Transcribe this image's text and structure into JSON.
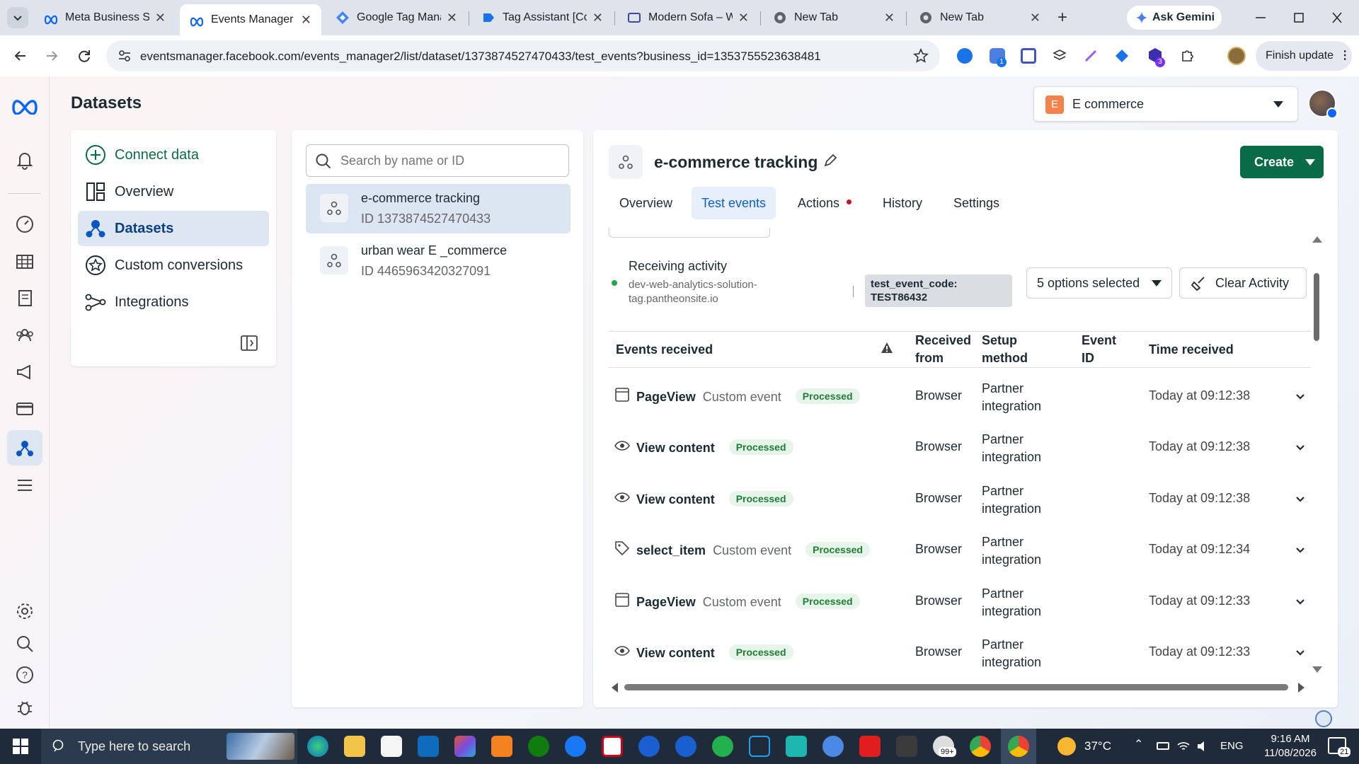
{
  "browser": {
    "tabs": [
      {
        "title": "Meta Business Su",
        "active": false
      },
      {
        "title": "Events Manager",
        "active": true
      },
      {
        "title": "Google Tag Mana",
        "active": false
      },
      {
        "title": "Tag Assistant [Co",
        "active": false
      },
      {
        "title": "Modern Sofa – W",
        "active": false
      },
      {
        "title": "New Tab",
        "active": false
      },
      {
        "title": "New Tab",
        "active": false
      }
    ],
    "url": "eventsmanager.facebook.com/events_manager2/list/dataset/1373874527470433/test_events?business_id=1353755523638481",
    "ask_gemini": "Ask Gemini",
    "finish_update": "Finish update",
    "ext_badge_1": "1",
    "ext_badge_2": "3"
  },
  "page": {
    "title": "Datasets",
    "account": {
      "initial": "E",
      "name": "E commerce"
    }
  },
  "nav": {
    "items": [
      {
        "label": "Connect data",
        "icon": "plus-circle-icon"
      },
      {
        "label": "Overview",
        "icon": "overview-icon"
      },
      {
        "label": "Datasets",
        "icon": "datasets-icon",
        "selected": true
      },
      {
        "label": "Custom conversions",
        "icon": "custom-conversions-icon"
      },
      {
        "label": "Integrations",
        "icon": "integrations-icon"
      }
    ]
  },
  "datasets": {
    "search_placeholder": "Search by name or ID",
    "items": [
      {
        "name": "e-commerce tracking",
        "id": "ID 1373874527470433",
        "selected": true
      },
      {
        "name": "urban wear E _commerce",
        "id": "ID 4465963420327091",
        "selected": false
      }
    ]
  },
  "detail": {
    "title": "e-commerce tracking",
    "create_label": "Create",
    "tabs": [
      "Overview",
      "Test events",
      "Actions",
      "History",
      "Settings"
    ],
    "activity": {
      "status": "Receiving activity",
      "site_line1": "dev-web-analytics-solution-",
      "site_line2": "tag.pantheonsite.io",
      "code_line1": "test_event_code:",
      "code_line2": "TEST86432",
      "filter": "5 options selected",
      "clear": "Clear Activity"
    },
    "columns": {
      "events": "Events received",
      "from_1": "Received",
      "from_2": "from",
      "setup_1": "Setup",
      "setup_2": "method",
      "eid_1": "Event",
      "eid_2": "ID",
      "time": "Time received"
    },
    "events": [
      {
        "name": "PageView",
        "type": "Custom event",
        "status": "Processed",
        "from": "Browser",
        "setup_1": "Partner",
        "setup_2": "integration",
        "time": "Today at 09:12:38",
        "icon": "page-icon"
      },
      {
        "name": "View content",
        "type": "",
        "status": "Processed",
        "from": "Browser",
        "setup_1": "Partner",
        "setup_2": "integration",
        "time": "Today at 09:12:38",
        "icon": "eye-icon"
      },
      {
        "name": "View content",
        "type": "",
        "status": "Processed",
        "from": "Browser",
        "setup_1": "Partner",
        "setup_2": "integration",
        "time": "Today at 09:12:38",
        "icon": "eye-icon"
      },
      {
        "name": "select_item",
        "type": "Custom event",
        "status": "Processed",
        "from": "Browser",
        "setup_1": "Partner",
        "setup_2": "integration",
        "time": "Today at 09:12:34",
        "icon": "tag-icon"
      },
      {
        "name": "PageView",
        "type": "Custom event",
        "status": "Processed",
        "from": "Browser",
        "setup_1": "Partner",
        "setup_2": "integration",
        "time": "Today at 09:12:33",
        "icon": "page-icon"
      },
      {
        "name": "View content",
        "type": "",
        "status": "Processed",
        "from": "Browser",
        "setup_1": "Partner",
        "setup_2": "integration",
        "time": "Today at 09:12:33",
        "icon": "eye-icon"
      }
    ]
  },
  "taskbar": {
    "search_placeholder": "Type here to search",
    "temp": "37°C",
    "lang": "ENG",
    "time": "9:16 AM",
    "date": "11/08/2026",
    "notif": "21",
    "badge_99": "99+"
  },
  "colors": {
    "accent_green": "#0a6b48",
    "selected_blue": "#0b5fcc",
    "nav_bg": "#dde6f1"
  }
}
